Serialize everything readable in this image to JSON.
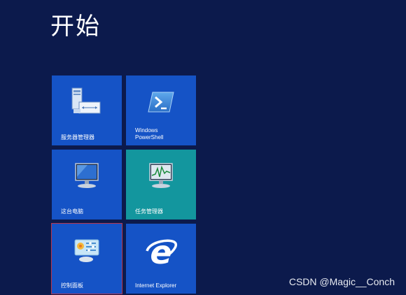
{
  "header": {
    "title": "开始"
  },
  "tiles": [
    {
      "label": "服务器管理器",
      "icon": "server-manager-icon",
      "color": "#1553c6"
    },
    {
      "label": "Windows\nPowerShell",
      "icon": "powershell-icon",
      "color": "#1553c6"
    },
    {
      "label": "这台电脑",
      "icon": "computer-monitor-icon",
      "color": "#1553c6"
    },
    {
      "label": "任务管理器",
      "icon": "task-manager-icon",
      "color": "#13969e"
    },
    {
      "label": "控制面板",
      "icon": "control-panel-icon",
      "color": "#1553c6"
    },
    {
      "label": "Internet Explorer",
      "icon": "internet-explorer-icon",
      "color": "#1553c6"
    }
  ],
  "watermark": {
    "text": "CSDN @Magic__Conch"
  },
  "colors": {
    "background": "#0c1a4c",
    "tile_blue": "#1553c6",
    "tile_teal": "#13969e",
    "selection_outline": "#b8364d"
  }
}
